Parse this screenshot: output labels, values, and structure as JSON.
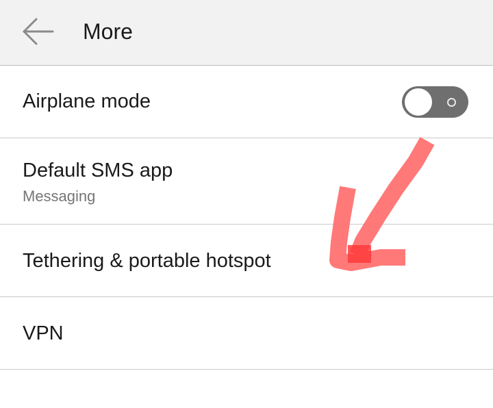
{
  "header": {
    "title": "More",
    "back_icon": "arrow-left-icon"
  },
  "rows": [
    {
      "title": "Airplane mode",
      "control": {
        "type": "toggle",
        "state": "off"
      }
    },
    {
      "title": "Default SMS app",
      "subtitle": "Messaging"
    },
    {
      "title": "Tethering & portable hotspot"
    },
    {
      "title": "VPN"
    }
  ],
  "annotation": {
    "type": "hand-drawn-arrow",
    "color": "#ff6e6e",
    "points_to": "Tethering & portable hotspot"
  },
  "colors": {
    "header_bg": "#f2f2f2",
    "divider": "#c9c9c9",
    "subtitle": "#757575",
    "toggle_track_off": "#6f6f6f"
  }
}
